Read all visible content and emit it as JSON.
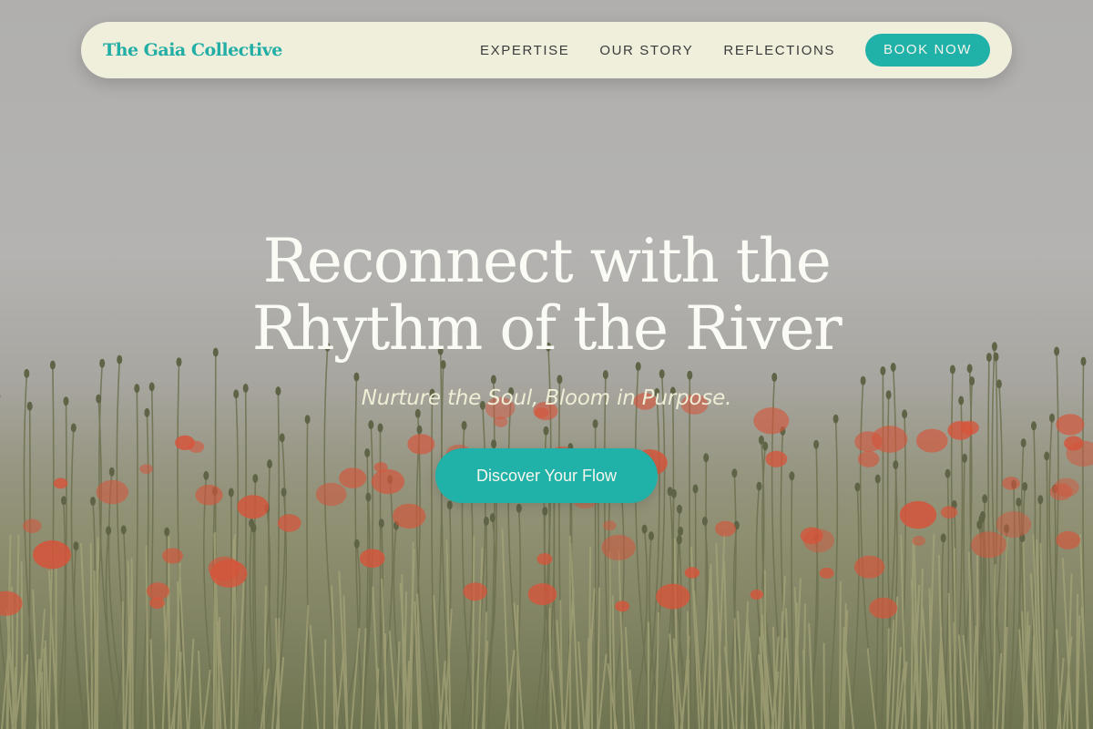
{
  "nav": {
    "brand": "The Gaia Collective",
    "links": [
      "EXPERTISE",
      "OUR STORY",
      "REFLECTIONS"
    ],
    "book_label": "BOOK NOW"
  },
  "hero": {
    "title_line1": "Reconnect with the",
    "title_line2": "Rhythm of the River",
    "subtitle": "Nurture the Soul, Bloom in Purpose.",
    "cta_label": "Discover Your Flow"
  },
  "colors": {
    "accent": "#20b1a8",
    "nav_background": "#efefdc",
    "poppy": "#d6543a",
    "grass": "#7d7f5f"
  }
}
